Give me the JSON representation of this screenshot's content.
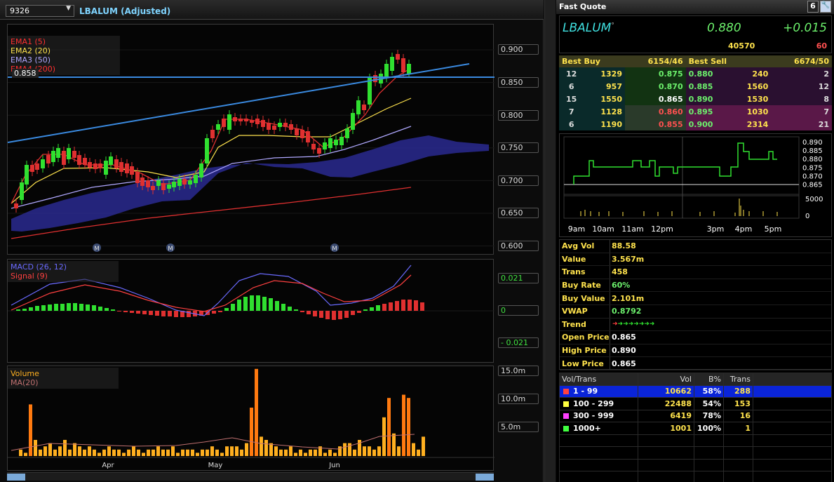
{
  "chart": {
    "code": "9326",
    "title": "LBALUM (Adjusted)",
    "price_legend": [
      {
        "label": "EMA1 (5)",
        "color": "#ff3030"
      },
      {
        "label": "EMA2 (20)",
        "color": "#ffe34d"
      },
      {
        "label": "EMA3 (50)",
        "color": "#b0a8ff"
      },
      {
        "label": "EMA4 (200)",
        "color": "#ff3030"
      }
    ],
    "hover_price": "0.858",
    "price_axis": [
      "0.900",
      "0.850",
      "0.800",
      "0.750",
      "0.700",
      "0.650",
      "0.600"
    ],
    "macd_legend": [
      {
        "label": "MACD (26, 12)",
        "color": "#6a6aff"
      },
      {
        "label": "Signal (9)",
        "color": "#ff4040"
      }
    ],
    "macd_axis": [
      "0.021",
      "0",
      "- 0.021"
    ],
    "vol_legend": [
      {
        "label": "Volume",
        "color": "#ffb020"
      },
      {
        "label": "MA(20)",
        "color": "#c07070"
      }
    ],
    "vol_axis": [
      "15.0m",
      "10.0m",
      "5.0m"
    ],
    "months": [
      "Apr",
      "May",
      "Jun"
    ],
    "m_marker": "M"
  },
  "quote": {
    "header": "Fast Quote",
    "header_num": "6",
    "stock": "LBALUM",
    "stock_mark": "°",
    "price": "0.880",
    "change": "+0.015",
    "volume": "40570",
    "sub_value": "60",
    "best_buy_label": "Best Buy",
    "best_buy": "6154/46",
    "best_sell_label": "Best Sell",
    "best_sell": "6674/50",
    "depth": [
      {
        "bq": "12",
        "bv": "1329",
        "bp": "0.875",
        "sp": "0.880",
        "sv": "240",
        "sq": "2"
      },
      {
        "bq": "6",
        "bv": "957",
        "bp": "0.870",
        "sp": "0.885",
        "sv": "1560",
        "sq": "12"
      },
      {
        "bq": "15",
        "bv": "1550",
        "bp": "0.865",
        "sp": "0.890",
        "sv": "1530",
        "sq": "8"
      },
      {
        "bq": "7",
        "bv": "1128",
        "bp": "0.860",
        "sp": "0.895",
        "sv": "1030",
        "sq": "7"
      },
      {
        "bq": "6",
        "bv": "1190",
        "bp": "0.855",
        "sp": "0.900",
        "sv": "2314",
        "sq": "21"
      }
    ],
    "intraday_axis": [
      "0.890",
      "0.885",
      "0.880",
      "0.875",
      "0.870",
      "0.865"
    ],
    "intraday_vol_axis": [
      "5000",
      "0"
    ],
    "time_axis": [
      "9am",
      "10am",
      "11am",
      "12pm",
      "3pm",
      "4pm",
      "5pm"
    ],
    "stats": [
      {
        "k": "Avg Vol",
        "v": "88.58"
      },
      {
        "k": "Value",
        "v": "3.567m"
      },
      {
        "k": "Trans",
        "v": "458"
      },
      {
        "k": "Buy Rate",
        "v": "60%"
      },
      {
        "k": "Buy Value",
        "v": "2.101m"
      },
      {
        "k": "VWAP",
        "v": "0.8792"
      },
      {
        "k": "Trend",
        "v": ""
      },
      {
        "k": "Open Price",
        "v": "0.865"
      },
      {
        "k": "High Price",
        "v": "0.890"
      },
      {
        "k": "Low Price",
        "v": "0.865"
      }
    ],
    "voltrans_header": [
      "Vol/Trans",
      "Vol",
      "B%",
      "Trans"
    ],
    "voltrans": [
      {
        "range": "1 - 99",
        "vol": "10662",
        "bp": "58%",
        "trans": "288",
        "color": "#ff4040"
      },
      {
        "range": "100 - 299",
        "vol": "22488",
        "bp": "54%",
        "trans": "153",
        "color": "#ffff40"
      },
      {
        "range": "300 - 999",
        "vol": "6419",
        "bp": "78%",
        "trans": "16",
        "color": "#ff40ff"
      },
      {
        "range": "1000+",
        "vol": "1001",
        "bp": "100%",
        "trans": "1",
        "color": "#40ff40"
      }
    ]
  }
}
